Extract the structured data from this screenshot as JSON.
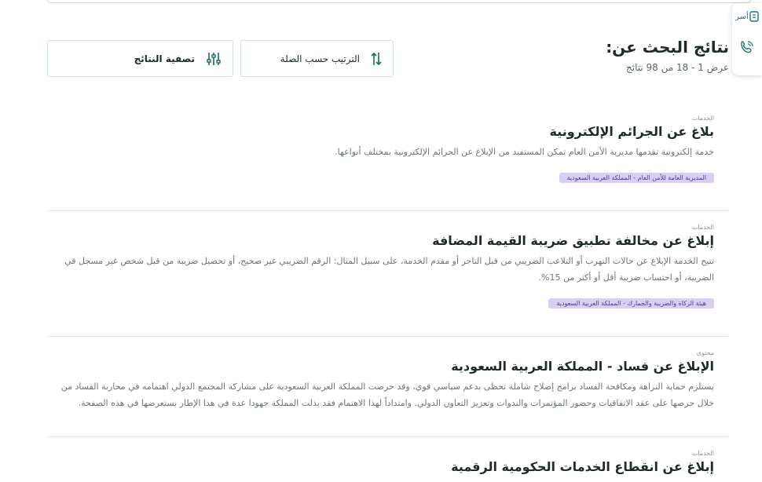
{
  "side_panel": {
    "items": [
      {
        "icon": "app-icon",
        "label": "أسر"
      },
      {
        "icon": "phone-icon",
        "label": ""
      }
    ]
  },
  "header": {
    "title": "نتائج البحث عن:",
    "count": "عرض 1 - 18 من 98 نتائج"
  },
  "controls": {
    "sort_label": "الترتيب حسب الصلة",
    "filter_label": "تصفية النتائج"
  },
  "results": [
    {
      "category": "الخدمات",
      "title": "بلاغ عن الجرائم الإلكترونية",
      "description": "خدمة إلكترونية تقدمها مديرية الأمن العام تمكن المستفيد من الإبلاغ عن الجرائم الإلكترونية بمختلف أنواعها.",
      "tag": "المديرية العامة للأمن العام - المملكة العربية السعودية"
    },
    {
      "category": "الخدمات",
      "title": "إبلاغ عن مخالفة تطبيق ضريبة القيمة المضافة",
      "description": "تتيح الخدمة الإبلاغ عن حالات التهرب أو التلاعب الضريبي من قبل التاجر أو مقدم الخدمة، على سبيل المثال: الرقم الضريبي غير صحيح، أو تحصيل ضريبة من قبل شخص غير مسجل في الضريبة، أو احتساب ضريبة أقل أو أكثر من 15%.",
      "tag": "هيئة الزكاة والضريبة والجمارك - المملكة العربية السعودية"
    },
    {
      "category": "محتوى",
      "title": "الإبلاغ عن فساد - المملكة العربية السعودية",
      "description": "يستلزم حماية النزاهة ومكافحة الفساد برامج إصلاح شاملة تحظى بدعم سياسي قوي، وقد حرصت المملكة العربية السعودية على مشاركة المجتمع الدولي اهتمامه في محاربة الفساد من خلال حرصها على عقد الاتفاقيات وحضور المؤتمرات والندوات وتعزيز التعاون الدولي. وامتداداً لهذا الاهتمام فقد بذلت المملكة جهودا عدة في هذا الإطار نستعرضها في هذه الصفحة.",
      "tag": ""
    },
    {
      "category": "الخدمات",
      "title": "إبلاغ عن انقطاع الخدمات الحكومية الرقمية",
      "description": "",
      "tag": ""
    }
  ]
}
